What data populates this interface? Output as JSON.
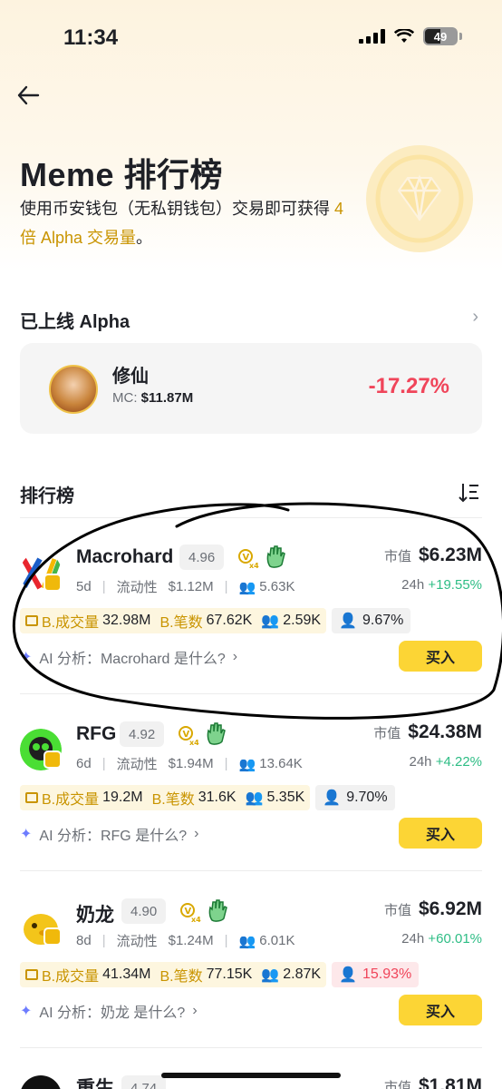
{
  "status_bar": {
    "time": "11:34",
    "battery": "49"
  },
  "header": {
    "title": "Meme 排行榜",
    "desc_part1": "使用币安钱包（无私钥钱包）交易即可获得",
    "desc_highlight": "4 倍 Alpha 交易量",
    "desc_part2": "。"
  },
  "alpha_section": {
    "title": "已上线 Alpha",
    "card": {
      "name": "修仙",
      "mc_label": "MC:",
      "mc_value": "$11.87M",
      "change": "-17.27%"
    }
  },
  "leaderboard": {
    "title": "排行榜",
    "items": [
      {
        "name": "Macrohard",
        "score": "4.96",
        "v_multiplier": "x4",
        "age": "5d",
        "liquidity_label": "流动性",
        "liquidity": "$1.12M",
        "holders": "5.63K",
        "mcap_label": "市值",
        "mcap": "$6.23M",
        "chg_label": "24h",
        "chg": "+19.55%",
        "vol_label": "B.成交量",
        "vol": "32.98M",
        "txn_label": "B.笔数",
        "txn": "67.62K",
        "traders": "2.59K",
        "top_holders": "9.67%",
        "ai_text": "AI 分析：Macrohard 是什么?",
        "buy": "买入"
      },
      {
        "name": "RFG",
        "score": "4.92",
        "v_multiplier": "x4",
        "age": "6d",
        "liquidity_label": "流动性",
        "liquidity": "$1.94M",
        "holders": "13.64K",
        "mcap_label": "市值",
        "mcap": "$24.38M",
        "chg_label": "24h",
        "chg": "+4.22%",
        "vol_label": "B.成交量",
        "vol": "19.2M",
        "txn_label": "B.笔数",
        "txn": "31.6K",
        "traders": "5.35K",
        "top_holders": "9.70%",
        "ai_text": "AI 分析：RFG 是什么?",
        "buy": "买入"
      },
      {
        "name": "奶龙",
        "score": "4.90",
        "v_multiplier": "x4",
        "age": "8d",
        "liquidity_label": "流动性",
        "liquidity": "$1.24M",
        "holders": "6.01K",
        "mcap_label": "市值",
        "mcap": "$6.92M",
        "chg_label": "24h",
        "chg": "+60.01%",
        "vol_label": "B.成交量",
        "vol": "41.34M",
        "txn_label": "B.笔数",
        "txn": "77.15K",
        "traders": "2.87K",
        "top_holders": "15.93%",
        "ai_text": "AI 分析：奶龙 是什么?",
        "buy": "买入"
      },
      {
        "name": "重生",
        "score": "4.74",
        "mcap_label": "市值",
        "mcap": "$1.81M"
      }
    ]
  }
}
